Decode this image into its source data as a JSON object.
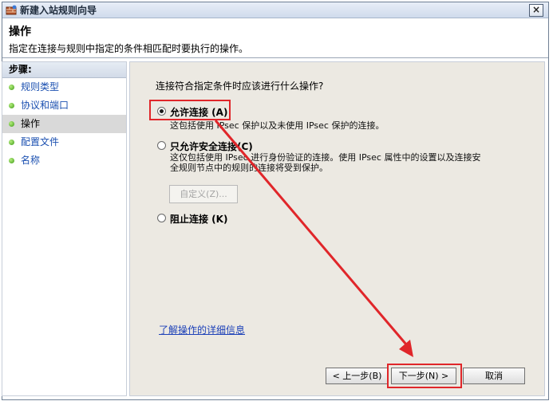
{
  "window": {
    "title": "新建入站规则向导",
    "close_glyph": "×"
  },
  "header": {
    "title": "操作",
    "description": "指定在连接与规则中指定的条件相匹配时要执行的操作。"
  },
  "sidebar": {
    "heading": "步骤:",
    "items": [
      {
        "label": "规则类型"
      },
      {
        "label": "协议和端口"
      },
      {
        "label": "操作"
      },
      {
        "label": "配置文件"
      },
      {
        "label": "名称"
      }
    ]
  },
  "main": {
    "question": "连接符合指定条件时应该进行什么操作?",
    "options": [
      {
        "label": "允许连接 (A)",
        "description": "这包括使用 IPsec 保护以及未使用 IPsec 保护的连接。",
        "selected": true
      },
      {
        "label": "只允许安全连接(C)",
        "description_line1": "这仅包括使用 IPsec 进行身份验证的连接。使用 IPsec 属性中的设置以及连接安",
        "description_line2": "全规则节点中的规则的连接将受到保护。",
        "selected": false
      },
      {
        "label": "阻止连接 (K)",
        "selected": false
      }
    ],
    "customize_button": "自定义(Z)...",
    "details_link": "了解操作的详细信息"
  },
  "buttons": {
    "back": "< 上一步(B)",
    "next": "下一步(N) >",
    "cancel": "取消"
  },
  "colors": {
    "annotation": "#e0262a",
    "link": "#1d41b8",
    "content_bg": "#ece9e2"
  }
}
